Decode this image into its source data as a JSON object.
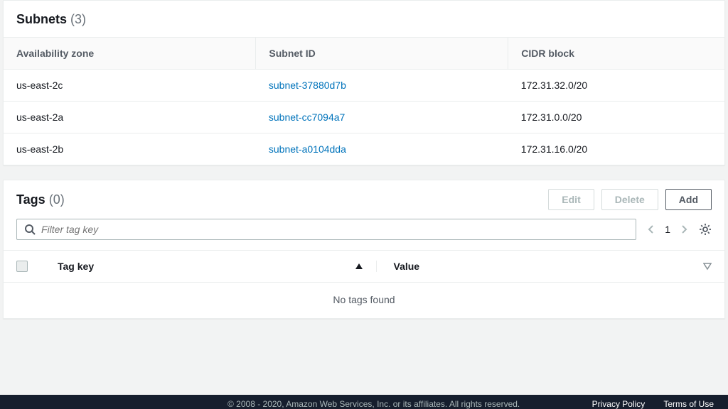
{
  "subnets": {
    "title": "Subnets",
    "count": "(3)",
    "columns": {
      "az": "Availability zone",
      "id": "Subnet ID",
      "cidr": "CIDR block"
    },
    "rows": [
      {
        "az": "us-east-2c",
        "id": "subnet-37880d7b",
        "cidr": "172.31.32.0/20"
      },
      {
        "az": "us-east-2a",
        "id": "subnet-cc7094a7",
        "cidr": "172.31.0.0/20"
      },
      {
        "az": "us-east-2b",
        "id": "subnet-a0104dda",
        "cidr": "172.31.16.0/20"
      }
    ]
  },
  "tags": {
    "title": "Tags",
    "count": "(0)",
    "buttons": {
      "edit": "Edit",
      "delete": "Delete",
      "add": "Add"
    },
    "filter_placeholder": "Filter tag key",
    "page": "1",
    "columns": {
      "key": "Tag key",
      "value": "Value"
    },
    "empty": "No tags found"
  },
  "footer": {
    "copyright": "© 2008 - 2020, Amazon Web Services, Inc. or its affiliates. All rights reserved.",
    "privacy": "Privacy Policy",
    "terms": "Terms of Use"
  }
}
